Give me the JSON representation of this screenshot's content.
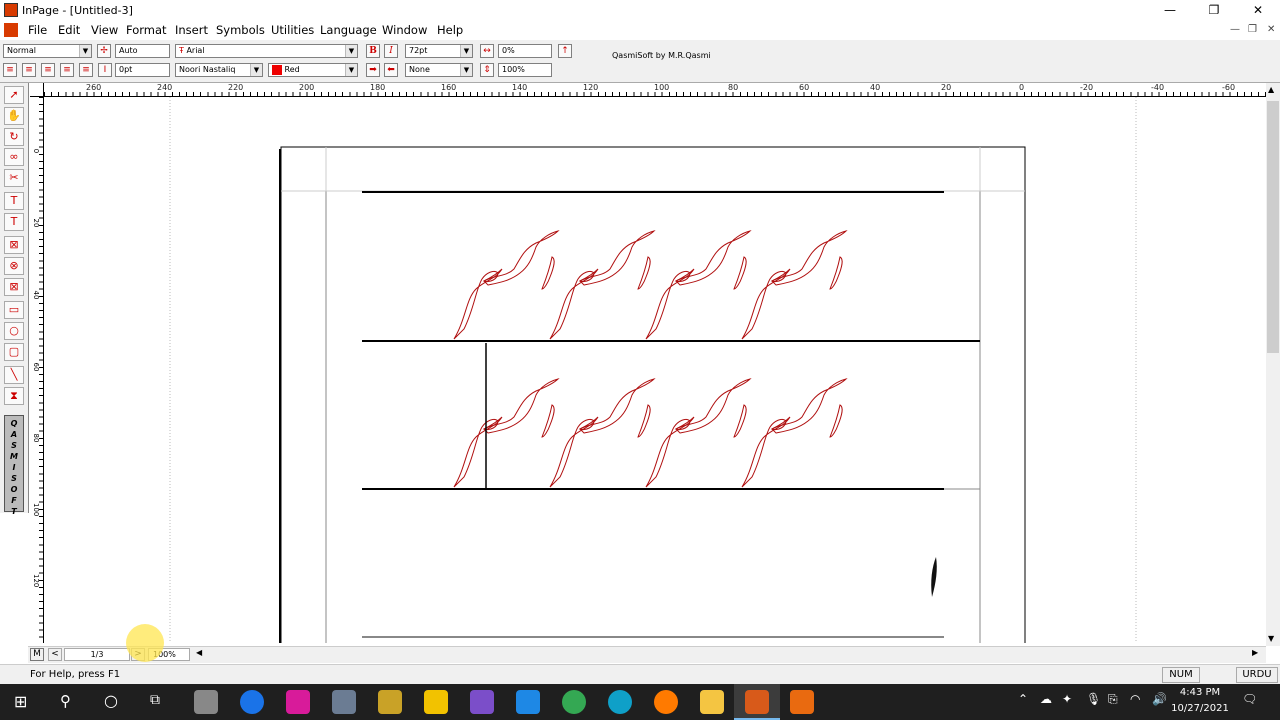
{
  "window": {
    "title": "InPage - [Untitled-3]",
    "minimize": "—",
    "restore": "❐",
    "close": "✕"
  },
  "menu": [
    "File",
    "Edit",
    "View",
    "Format",
    "Insert",
    "Symbols",
    "Utilities",
    "Language",
    "Window",
    "Help"
  ],
  "toolbar": {
    "style": "Normal",
    "leading": "Auto",
    "font_latin": "Arial",
    "font_urdu": "Noori Nastaliq",
    "size": "72pt",
    "spacing_top": "0pt",
    "tracking": "0%",
    "scale": "100%",
    "color": "Red",
    "shade": "None",
    "bold": "B",
    "italic": "I",
    "credit": "QasmiSoft by M.R.Qasmi"
  },
  "ruler_h": [
    "260",
    "240",
    "220",
    "200",
    "180",
    "160",
    "140",
    "120",
    "100",
    "80",
    "60",
    "40",
    "20",
    "0",
    "-20",
    "-40",
    "-60"
  ],
  "ruler_v": [
    "0",
    "20",
    "40",
    "60",
    "80",
    "100",
    "120"
  ],
  "qasmi_strip": [
    "Q",
    "A",
    "S",
    "M",
    "I",
    "S",
    "O",
    "F",
    "T"
  ],
  "nav": {
    "master": "M",
    "prev": "<",
    "page": "1/3",
    "next": ">",
    "zoom": "100%"
  },
  "status": {
    "help": "For Help, press F1",
    "num": "NUM",
    "lang": "URDU"
  },
  "clock": {
    "time": "4:43 PM",
    "date": "10/27/2021"
  },
  "colors": {
    "accent": "#c00000",
    "calligraphy": "#b01010"
  }
}
